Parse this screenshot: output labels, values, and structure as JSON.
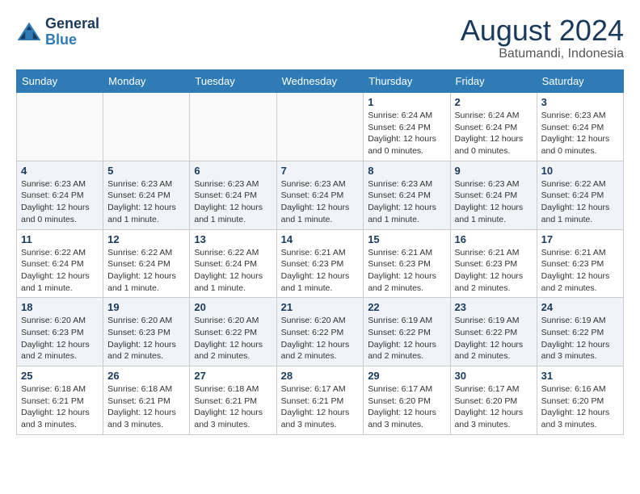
{
  "header": {
    "logo_line1": "General",
    "logo_line2": "Blue",
    "month_title": "August 2024",
    "location": "Batumandi, Indonesia"
  },
  "weekdays": [
    "Sunday",
    "Monday",
    "Tuesday",
    "Wednesday",
    "Thursday",
    "Friday",
    "Saturday"
  ],
  "weeks": [
    [
      {
        "day": "",
        "info": ""
      },
      {
        "day": "",
        "info": ""
      },
      {
        "day": "",
        "info": ""
      },
      {
        "day": "",
        "info": ""
      },
      {
        "day": "1",
        "info": "Sunrise: 6:24 AM\nSunset: 6:24 PM\nDaylight: 12 hours\nand 0 minutes."
      },
      {
        "day": "2",
        "info": "Sunrise: 6:24 AM\nSunset: 6:24 PM\nDaylight: 12 hours\nand 0 minutes."
      },
      {
        "day": "3",
        "info": "Sunrise: 6:23 AM\nSunset: 6:24 PM\nDaylight: 12 hours\nand 0 minutes."
      }
    ],
    [
      {
        "day": "4",
        "info": "Sunrise: 6:23 AM\nSunset: 6:24 PM\nDaylight: 12 hours\nand 0 minutes."
      },
      {
        "day": "5",
        "info": "Sunrise: 6:23 AM\nSunset: 6:24 PM\nDaylight: 12 hours\nand 1 minute."
      },
      {
        "day": "6",
        "info": "Sunrise: 6:23 AM\nSunset: 6:24 PM\nDaylight: 12 hours\nand 1 minute."
      },
      {
        "day": "7",
        "info": "Sunrise: 6:23 AM\nSunset: 6:24 PM\nDaylight: 12 hours\nand 1 minute."
      },
      {
        "day": "8",
        "info": "Sunrise: 6:23 AM\nSunset: 6:24 PM\nDaylight: 12 hours\nand 1 minute."
      },
      {
        "day": "9",
        "info": "Sunrise: 6:23 AM\nSunset: 6:24 PM\nDaylight: 12 hours\nand 1 minute."
      },
      {
        "day": "10",
        "info": "Sunrise: 6:22 AM\nSunset: 6:24 PM\nDaylight: 12 hours\nand 1 minute."
      }
    ],
    [
      {
        "day": "11",
        "info": "Sunrise: 6:22 AM\nSunset: 6:24 PM\nDaylight: 12 hours\nand 1 minute."
      },
      {
        "day": "12",
        "info": "Sunrise: 6:22 AM\nSunset: 6:24 PM\nDaylight: 12 hours\nand 1 minute."
      },
      {
        "day": "13",
        "info": "Sunrise: 6:22 AM\nSunset: 6:24 PM\nDaylight: 12 hours\nand 1 minute."
      },
      {
        "day": "14",
        "info": "Sunrise: 6:21 AM\nSunset: 6:23 PM\nDaylight: 12 hours\nand 1 minute."
      },
      {
        "day": "15",
        "info": "Sunrise: 6:21 AM\nSunset: 6:23 PM\nDaylight: 12 hours\nand 2 minutes."
      },
      {
        "day": "16",
        "info": "Sunrise: 6:21 AM\nSunset: 6:23 PM\nDaylight: 12 hours\nand 2 minutes."
      },
      {
        "day": "17",
        "info": "Sunrise: 6:21 AM\nSunset: 6:23 PM\nDaylight: 12 hours\nand 2 minutes."
      }
    ],
    [
      {
        "day": "18",
        "info": "Sunrise: 6:20 AM\nSunset: 6:23 PM\nDaylight: 12 hours\nand 2 minutes."
      },
      {
        "day": "19",
        "info": "Sunrise: 6:20 AM\nSunset: 6:23 PM\nDaylight: 12 hours\nand 2 minutes."
      },
      {
        "day": "20",
        "info": "Sunrise: 6:20 AM\nSunset: 6:22 PM\nDaylight: 12 hours\nand 2 minutes."
      },
      {
        "day": "21",
        "info": "Sunrise: 6:20 AM\nSunset: 6:22 PM\nDaylight: 12 hours\nand 2 minutes."
      },
      {
        "day": "22",
        "info": "Sunrise: 6:19 AM\nSunset: 6:22 PM\nDaylight: 12 hours\nand 2 minutes."
      },
      {
        "day": "23",
        "info": "Sunrise: 6:19 AM\nSunset: 6:22 PM\nDaylight: 12 hours\nand 2 minutes."
      },
      {
        "day": "24",
        "info": "Sunrise: 6:19 AM\nSunset: 6:22 PM\nDaylight: 12 hours\nand 3 minutes."
      }
    ],
    [
      {
        "day": "25",
        "info": "Sunrise: 6:18 AM\nSunset: 6:21 PM\nDaylight: 12 hours\nand 3 minutes."
      },
      {
        "day": "26",
        "info": "Sunrise: 6:18 AM\nSunset: 6:21 PM\nDaylight: 12 hours\nand 3 minutes."
      },
      {
        "day": "27",
        "info": "Sunrise: 6:18 AM\nSunset: 6:21 PM\nDaylight: 12 hours\nand 3 minutes."
      },
      {
        "day": "28",
        "info": "Sunrise: 6:17 AM\nSunset: 6:21 PM\nDaylight: 12 hours\nand 3 minutes."
      },
      {
        "day": "29",
        "info": "Sunrise: 6:17 AM\nSunset: 6:20 PM\nDaylight: 12 hours\nand 3 minutes."
      },
      {
        "day": "30",
        "info": "Sunrise: 6:17 AM\nSunset: 6:20 PM\nDaylight: 12 hours\nand 3 minutes."
      },
      {
        "day": "31",
        "info": "Sunrise: 6:16 AM\nSunset: 6:20 PM\nDaylight: 12 hours\nand 3 minutes."
      }
    ]
  ]
}
